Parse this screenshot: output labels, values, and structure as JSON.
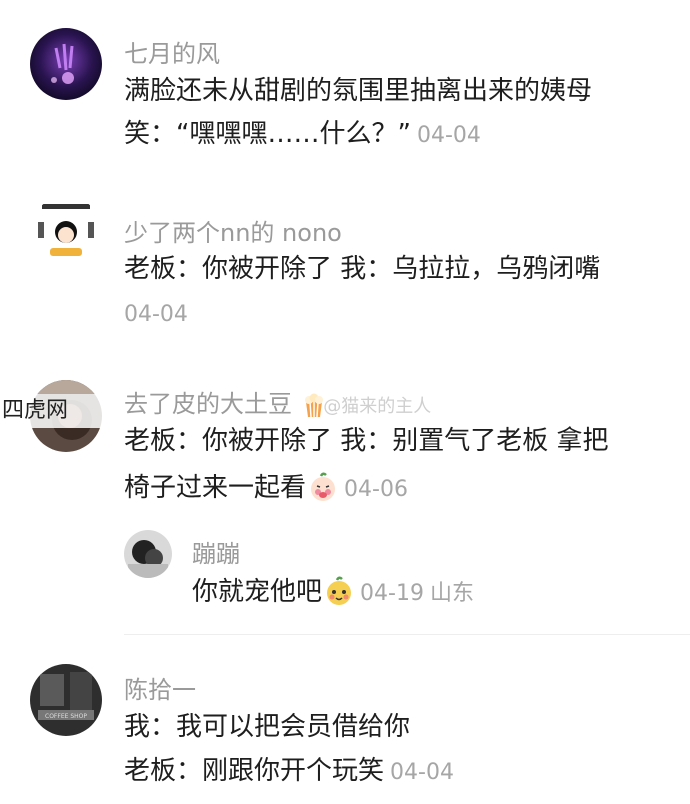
{
  "watermark": "四虎网",
  "comments": [
    {
      "name": "七月的风",
      "lines": [
        "满脸还未从甜剧的氛围里抽离出来的姨母",
        "笑：“嘿嘿嘿……什么？”"
      ],
      "time": "04-04"
    },
    {
      "name": "少了两个nn的 nono",
      "lines": [
        "老板：你被开除了 我：乌拉拉，乌鸦闭嘴"
      ],
      "time": "04-04"
    },
    {
      "name": "去了皮的大土豆",
      "name_overlay": "@猫来的主人",
      "lines": [
        "老板：你被开除了 我：别置气了老板 拿把",
        "椅子过来一起看"
      ],
      "time": "04-06",
      "reply": {
        "name": "蹦蹦",
        "text": "你就宠他吧",
        "time": "04-19",
        "location": "山东"
      }
    },
    {
      "name": "陈拾一",
      "lines": [
        "我：我可以把会员借给你",
        "老板：刚跟你开个玩笑"
      ],
      "time": "04-04"
    }
  ],
  "avatar_label": "COFFEE SHOP"
}
